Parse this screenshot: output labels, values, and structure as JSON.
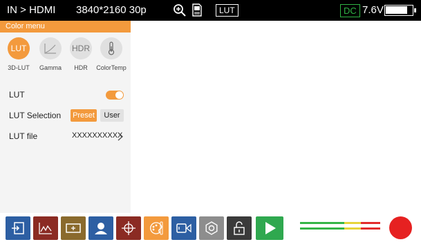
{
  "status_bar": {
    "input_source": "IN > HDMI",
    "resolution": "3840*2160 30p",
    "lut_indicator": "LUT",
    "power_source": "DC",
    "voltage": "7.6V",
    "battery_level_fraction": 0.85,
    "icons": [
      "zoom-in-icon",
      "sd-card-icon",
      "battery-icon"
    ]
  },
  "color_menu": {
    "title": "Color menu",
    "modes": [
      {
        "label": "3D-LUT",
        "icon_text": "LUT",
        "active": true
      },
      {
        "label": "Gamma",
        "icon": "gamma-curve-icon",
        "active": false
      },
      {
        "label": "HDR",
        "icon_text": "HDR",
        "active": false
      },
      {
        "label": "ColorTemp",
        "icon": "thermometer-icon",
        "active": false
      }
    ],
    "lut": {
      "label": "LUT",
      "enabled": true
    },
    "lut_selection": {
      "label": "LUT Selection",
      "options": [
        "Preset",
        "User"
      ],
      "selected": "Preset"
    },
    "lut_file": {
      "label": "LUT file",
      "value": "XXXXXXXXXX"
    }
  },
  "toolbar": {
    "buttons": [
      {
        "name": "input-icon",
        "color": "#2d5fa3"
      },
      {
        "name": "waveform-icon",
        "color": "#8b2b23"
      },
      {
        "name": "focus-frame-icon",
        "color": "#8a6a2d"
      },
      {
        "name": "user-icon",
        "color": "#2d5fa3"
      },
      {
        "name": "crosshair-icon",
        "color": "#8b2b23"
      },
      {
        "name": "color-palette-icon",
        "color": "#f39a3d"
      },
      {
        "name": "video-camera-icon",
        "color": "#2d5fa3"
      },
      {
        "name": "settings-icon",
        "color": "#8d8d8d"
      },
      {
        "name": "unlock-icon",
        "color": "#3a3a3a"
      },
      {
        "name": "play-icon",
        "color": "#2fa84f"
      }
    ],
    "audio_meter_channels": 2,
    "record_color": "#e62121"
  },
  "colors": {
    "accent": "#f39a3d",
    "dc_green": "#2fb344"
  }
}
